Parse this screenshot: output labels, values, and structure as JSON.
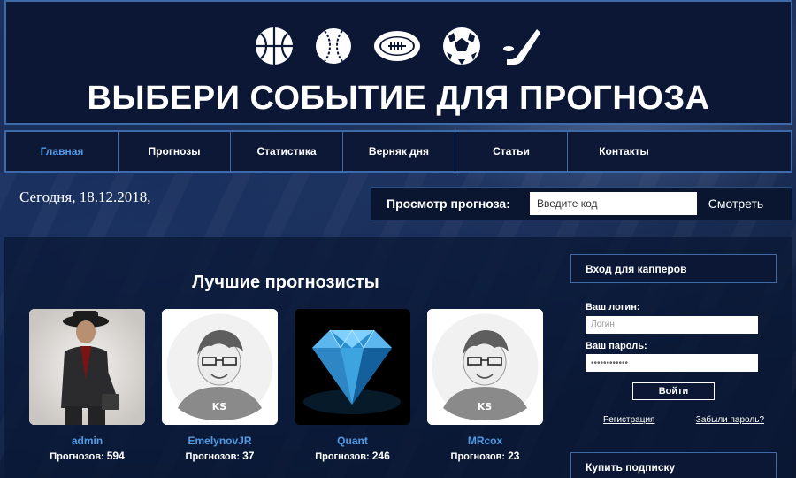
{
  "header": {
    "title": "ВЫБЕРИ СОБЫТИЕ ДЛЯ ПРОГНОЗА",
    "sport_icons": [
      "basketball-icon",
      "baseball-icon",
      "american-football-icon",
      "soccer-ball-icon",
      "hockey-stick-icon"
    ]
  },
  "nav": {
    "items": [
      {
        "label": "Главная",
        "active": true
      },
      {
        "label": "Прогнозы"
      },
      {
        "label": "Статистика"
      },
      {
        "label": "Верняк дня"
      },
      {
        "label": "Статьи"
      },
      {
        "label": "Контакты"
      }
    ]
  },
  "date_text": "Сегодня, 18.12.2018,",
  "lookup": {
    "label": "Просмотр прогноза:",
    "placeholder": "Введите код",
    "button": "Смотреть"
  },
  "top": {
    "title": "Лучшие прогнозисты",
    "count_label": "Прогнозов:",
    "users": [
      {
        "name": "admin",
        "count": "594",
        "avatar": "man-in-hat"
      },
      {
        "name": "EmelynovJR",
        "count": "37",
        "avatar": "default-ks"
      },
      {
        "name": "Quant",
        "count": "246",
        "avatar": "diamond"
      },
      {
        "name": "MRcox",
        "count": "23",
        "avatar": "default-ks"
      }
    ]
  },
  "login": {
    "title": "Вход для капперов",
    "login_label": "Ваш логин:",
    "login_placeholder": "Логин",
    "password_label": "Ваш пароль:",
    "password_value": "••••••••••••",
    "button": "Войти",
    "register": "Регистрация",
    "forgot": "Забыли пароль?"
  },
  "subscription": {
    "title": "Купить подписку"
  },
  "colors": {
    "accent": "#4f9be6",
    "border": "#3e6aa8",
    "panel": "#0b1735"
  }
}
